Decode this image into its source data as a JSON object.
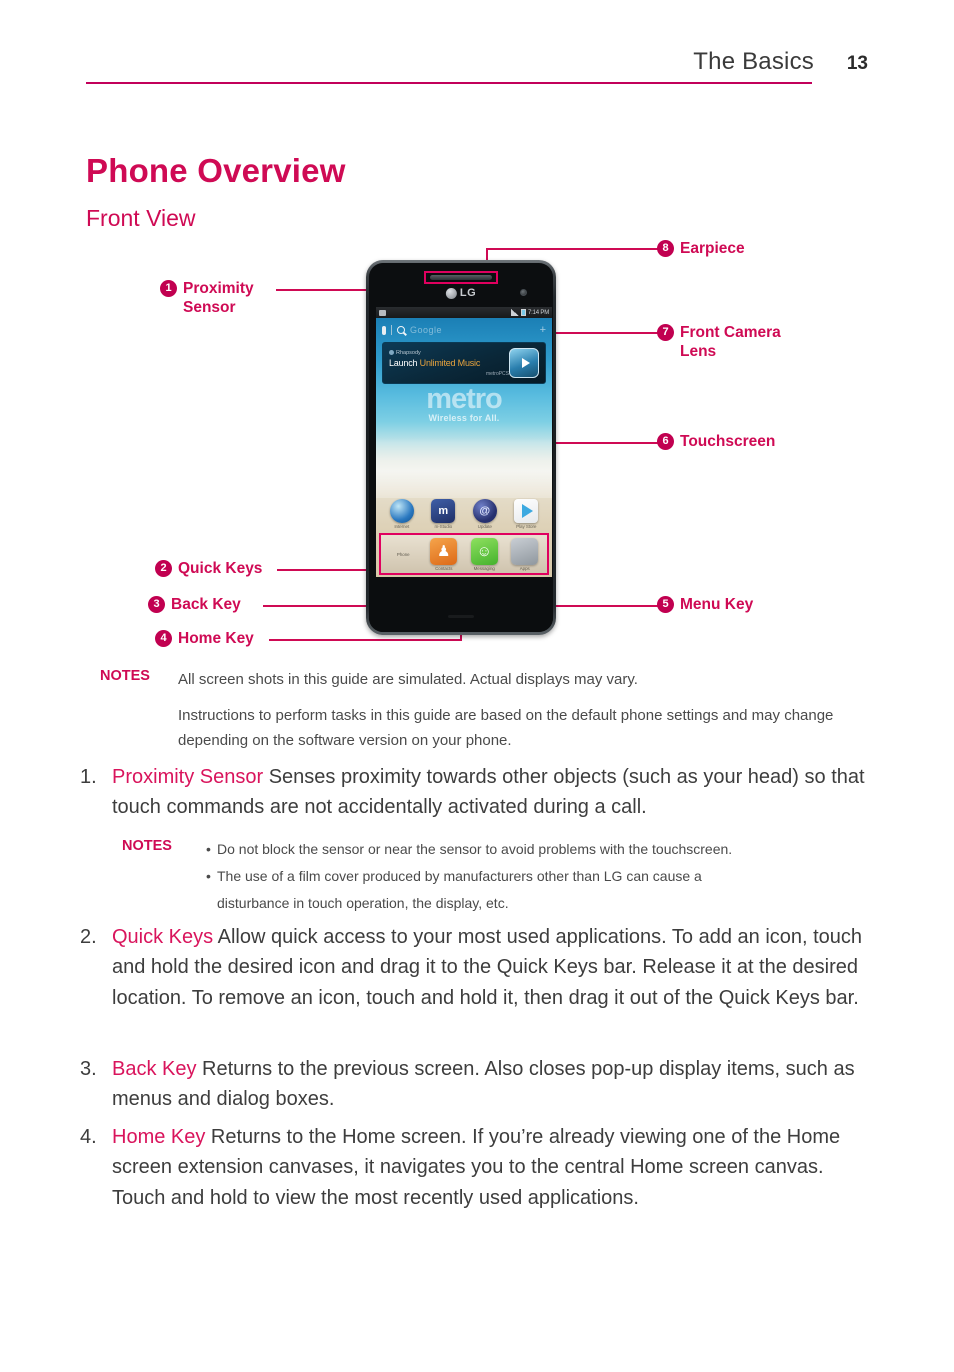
{
  "header": {
    "title": "The Basics",
    "page_number": "13"
  },
  "titles": {
    "main": "Phone Overview",
    "sub": "Front View"
  },
  "figure": {
    "callouts": [
      {
        "number": "1",
        "label": "Proximity\nSensor",
        "line1": "Proximity",
        "line2": "Sensor"
      },
      {
        "number": "2",
        "label": "Quick Keys"
      },
      {
        "number": "3",
        "label": "Back Key"
      },
      {
        "number": "4",
        "label": "Home Key"
      },
      {
        "number": "5",
        "label": "Menu Key"
      },
      {
        "number": "6",
        "label": "Touchscreen"
      },
      {
        "number": "7",
        "line1": "Front Camera",
        "line2": "Lens"
      },
      {
        "number": "8",
        "label": "Earpiece"
      }
    ],
    "phone_screen": {
      "brand": "LG",
      "status_time": "7:14 PM",
      "search_hint": "Google",
      "banner": {
        "brand": "Rhapsody",
        "line_prefix": "Launch ",
        "line_highlight": "Unlimited Music",
        "carrier": "metroPCS"
      },
      "wallpaper_mark": "metro",
      "wallpaper_sub": "Wireless for All.",
      "apps": [
        {
          "name": "browser-icon",
          "label": "Internet"
        },
        {
          "name": "mstudio-icon",
          "label": "m-Studio",
          "glyph": "m"
        },
        {
          "name": "update-icon",
          "label": "Update",
          "glyph": "@"
        },
        {
          "name": "play-store-icon",
          "label": "Play Store"
        }
      ],
      "quick_keys": [
        {
          "name": "phone-icon",
          "label": "Phone",
          "glyph": "✆"
        },
        {
          "name": "contacts-icon",
          "label": "Contacts",
          "glyph": "♟"
        },
        {
          "name": "messaging-icon",
          "label": "Messaging",
          "glyph": "☺"
        },
        {
          "name": "apps-icon",
          "label": "Apps"
        }
      ]
    }
  },
  "notes_top": {
    "label": "NOTES",
    "paragraphs": [
      "All screen shots in this guide are simulated. Actual displays may vary.",
      "Instructions to perform tasks in this guide are based on the default phone settings and may change depending on the software version on your phone."
    ]
  },
  "items": [
    {
      "number": "1.",
      "term": "Proximity Sensor",
      "text": " Senses proximity towards other objects (such as your head) so that touch commands are not accidentally activated during a call."
    },
    {
      "number": "2.",
      "term": "Quick Keys",
      "text": " Allow quick access to your most used applications. To add an icon, touch and hold the desired icon and drag it to the Quick Keys bar. Release it at the desired location. To remove an icon, touch and hold it, then drag it out of the Quick Keys bar."
    },
    {
      "number": "3.",
      "term": "Back Key",
      "text": " Returns to the previous screen. Also closes pop-up display items, such as menus and dialog boxes."
    },
    {
      "number": "4.",
      "term": "Home Key",
      "text": " Returns to the Home screen. If you’re already viewing one of the Home screen extension canvases, it navigates you to the central Home screen canvas. Touch and hold to view the most recently used applications."
    }
  ],
  "notes_mid": {
    "label": "NOTES",
    "bullets": [
      "Do not block the sensor or near the sensor to avoid problems with the touchscreen.",
      "The use of a film cover produced by manufacturers other than LG can cause a",
      "disturbance in touch operation, the display, etc."
    ]
  },
  "colors": {
    "accent": "#cf0a54",
    "accent_dark": "#c10050",
    "rule": "#c2005a",
    "body_text": "#3d3d3d"
  }
}
